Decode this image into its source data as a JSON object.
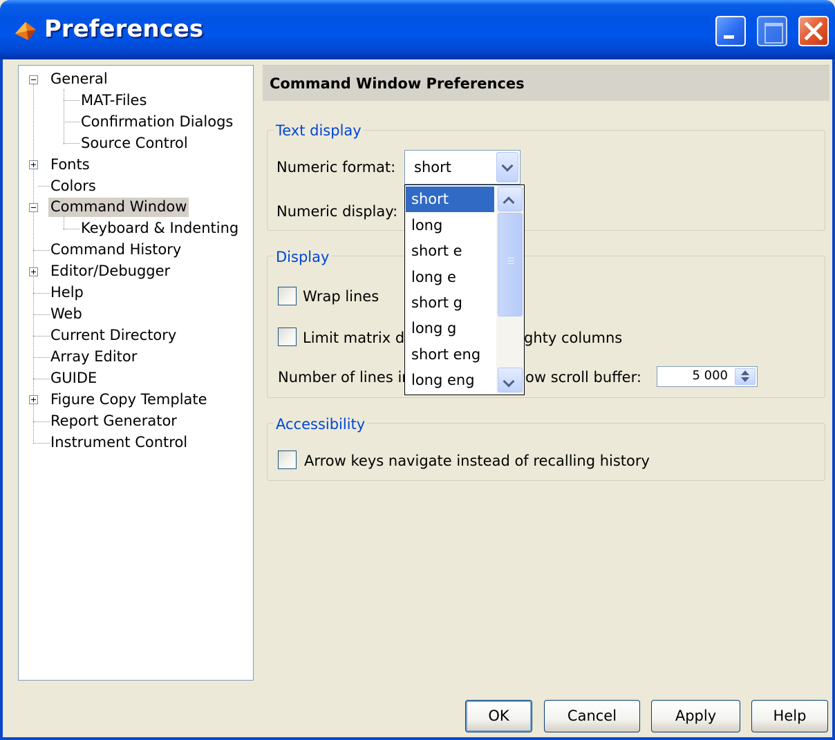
{
  "window": {
    "title": "Preferences"
  },
  "tree": {
    "items": [
      {
        "label": "General",
        "expander": "minus"
      },
      {
        "label": "MAT-Files"
      },
      {
        "label": "Confirmation Dialogs"
      },
      {
        "label": "Source Control"
      },
      {
        "label": "Fonts",
        "expander": "plus"
      },
      {
        "label": "Colors"
      },
      {
        "label": "Command Window",
        "expander": "minus",
        "selected": true
      },
      {
        "label": "Keyboard & Indenting"
      },
      {
        "label": "Command History"
      },
      {
        "label": "Editor/Debugger",
        "expander": "plus"
      },
      {
        "label": "Help"
      },
      {
        "label": "Web"
      },
      {
        "label": "Current Directory"
      },
      {
        "label": "Array Editor"
      },
      {
        "label": "GUIDE"
      },
      {
        "label": "Figure Copy Template",
        "expander": "plus"
      },
      {
        "label": "Report Generator"
      },
      {
        "label": "Instrument Control"
      }
    ]
  },
  "panel": {
    "title": "Command Window Preferences",
    "text_display": {
      "group_title": "Text display",
      "numeric_format_label": "Numeric format:",
      "numeric_format_value": "short",
      "numeric_display_label": "Numeric display:"
    },
    "display": {
      "group_title": "Display",
      "wrap_lines_label": "Wrap lines",
      "wrap_lines_checked": false,
      "limit_matrix_label_left": "Limit matrix dis",
      "limit_matrix_label_right": "ghty columns",
      "limit_matrix_checked": false,
      "scroll_buffer_label_left": "Number of lines ir",
      "scroll_buffer_label_right": "ow scroll buffer:",
      "scroll_buffer_value": "5 000"
    },
    "accessibility": {
      "group_title": "Accessibility",
      "arrow_keys_label": "Arrow keys navigate instead of recalling history",
      "arrow_keys_checked": false
    }
  },
  "dropdown": {
    "options": [
      "short",
      "long",
      "short e",
      "long e",
      "short g",
      "long g",
      "short eng",
      "long eng"
    ],
    "highlighted": "short"
  },
  "buttons": {
    "ok": "OK",
    "cancel": "Cancel",
    "apply": "Apply",
    "help": "Help"
  },
  "colors": {
    "titlebar": "#0054E3",
    "selection": "#316AC5",
    "group_title": "#0046D5",
    "dialog_bg": "#ECE9D8"
  }
}
